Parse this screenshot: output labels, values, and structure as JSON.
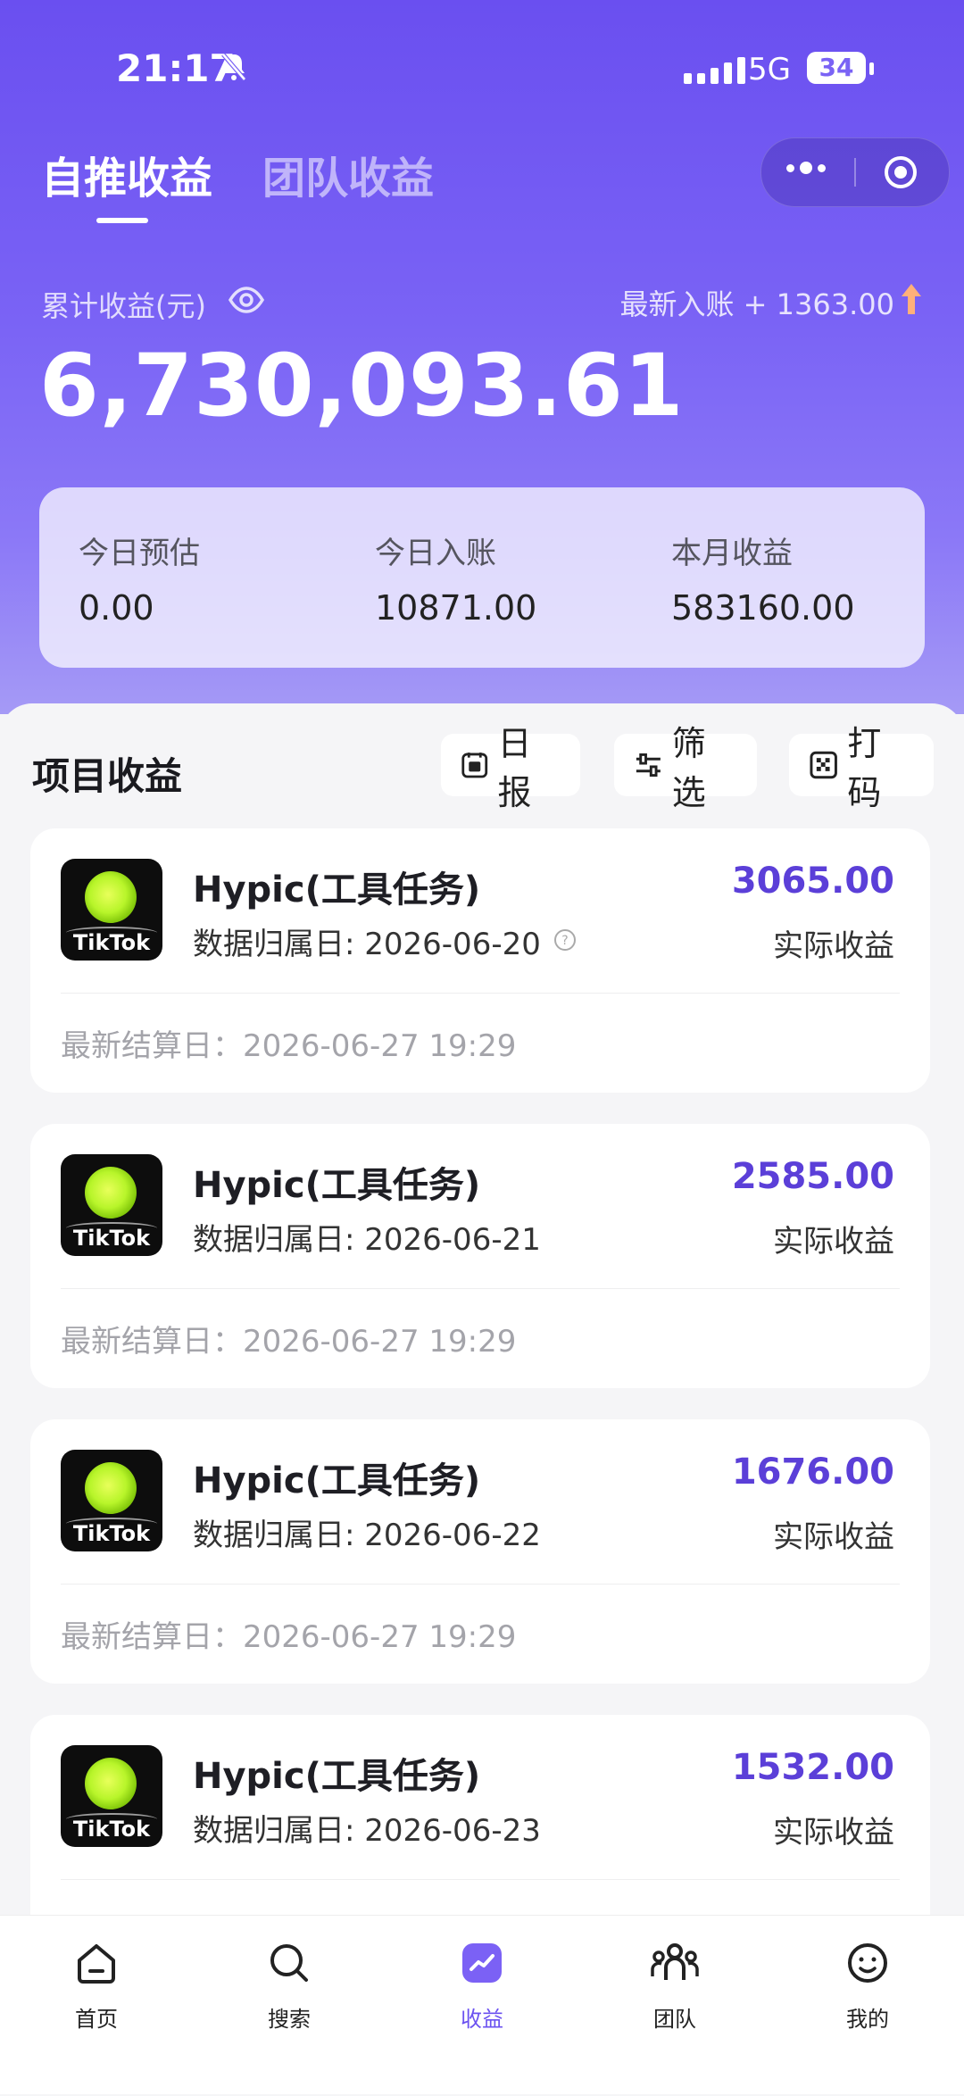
{
  "status_bar": {
    "time": "21:17",
    "network": "5G",
    "battery": "34"
  },
  "tabs": [
    {
      "label": "自推收益",
      "active": true
    },
    {
      "label": "团队收益",
      "active": false
    }
  ],
  "summary": {
    "cumulative_label": "累计收益(元)",
    "latest_label": "最新入账 + 1363.00",
    "cumulative_amount": "6,730,093.61"
  },
  "stats": [
    {
      "label": "今日预估",
      "value": "0.00"
    },
    {
      "label": "今日入账",
      "value": "10871.00"
    },
    {
      "label": "本月收益",
      "value": "583160.00"
    }
  ],
  "section": {
    "title": "项目收益",
    "actions": [
      {
        "label": "日报",
        "icon": "daily-report-icon"
      },
      {
        "label": "筛选",
        "icon": "filter-icon"
      },
      {
        "label": "打码",
        "icon": "mosaic-icon"
      }
    ]
  },
  "projects": [
    {
      "app": "TikTok",
      "name": "Hypic(工具任务)",
      "date": "数据归属日: 2026-06-20",
      "value": "3065.00",
      "value_label": "实际收益",
      "settle": "最新结算日：2026-06-27 19:29"
    },
    {
      "app": "TikTok",
      "name": "Hypic(工具任务)",
      "date": "数据归属日: 2026-06-21",
      "value": "2585.00",
      "value_label": "实际收益",
      "settle": "最新结算日：2026-06-27 19:29"
    },
    {
      "app": "TikTok",
      "name": "Hypic(工具任务)",
      "date": "数据归属日: 2026-06-22",
      "value": "1676.00",
      "value_label": "实际收益",
      "settle": "最新结算日：2026-06-27 19:29"
    },
    {
      "app": "TikTok",
      "name": "Hypic(工具任务)",
      "date": "数据归属日: 2026-06-23",
      "value": "1532.00",
      "value_label": "实际收益"
    }
  ],
  "bottom_nav": [
    {
      "label": "首页",
      "icon": "home-icon"
    },
    {
      "label": "搜索",
      "icon": "search-icon"
    },
    {
      "label": "收益",
      "icon": "earnings-icon",
      "active": true
    },
    {
      "label": "团队",
      "icon": "team-icon"
    },
    {
      "label": "我的",
      "icon": "profile-icon"
    }
  ],
  "colors": {
    "primary": "#6b52f0",
    "value_text": "#5b3fd8",
    "background": "#f5f5f7"
  }
}
